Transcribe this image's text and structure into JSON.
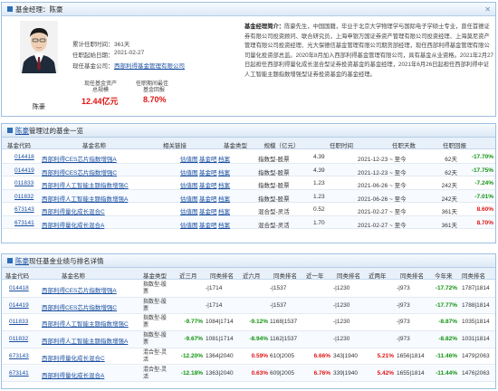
{
  "manager": {
    "header_label": "基金经理：",
    "name": "陈豪",
    "caption": "陈豪",
    "tenure_label": "累计任职时间：",
    "tenure_value": "361天",
    "start_label": "任职起始日期：",
    "start_value": "2021-02-27",
    "company_label": "现任基金公司：",
    "company_value": "西部利得基金管理有限公司",
    "scale_label_1": "现任基金资产",
    "scale_label_2": "总规模",
    "scale_value": "12.44亿元",
    "return_label_1": "任职期间最佳",
    "return_label_2": "基金回报",
    "return_value": "8.70%",
    "bio_title": "基金经理简介：",
    "bio_text": "陈豪先生，中国国籍，毕业于北京大学物理学与国际电子学硕士专业，曾任首德证券有限公司投资顾问、联合研究员，上海申银万国证券资产管理有限公司投资经理、上海莫尼资产管理有限公司投资经理、光大保德信基金管理有限公司期货部经理，现任西部利得基金管理有限公司量化投资部总监。2020年8月加入西部利得基金管理有限公司，具有基金从业资格。2021年2月27日起担任西部利得量化成长混合型证券投资基金的基金经理，2021年6月26日起担任西部利得中证人工智能主题指数增强型证券投资基金的基金经理。"
  },
  "managed_section": {
    "title_link": "陈豪",
    "title_rest": "管理过的基金一览",
    "headers": [
      "基金代码",
      "基金名称",
      "相关链接",
      "基金类型",
      "规模（亿元）",
      "任职时间",
      "任职天数",
      "任职回报"
    ],
    "rows": [
      {
        "code": "014418",
        "name": "西部利得CES芯片指数增强A",
        "links": [
          "估值图",
          "基金吧",
          "档案"
        ],
        "type": "指数型-股票",
        "size": "4.39",
        "period": "2021-12-23 ~ 至今",
        "days": "62天",
        "ret": "-17.70%"
      },
      {
        "code": "014419",
        "name": "西部利得CES芯片指数增强C",
        "links": [
          "估值图",
          "基金吧",
          "档案"
        ],
        "type": "指数型-股票",
        "size": "4.39",
        "period": "2021-12-23 ~ 至今",
        "days": "62天",
        "ret": "-17.75%"
      },
      {
        "code": "011833",
        "name": "西部利得人工智能主题指数增强C",
        "links": [
          "估值图",
          "基金吧",
          "档案"
        ],
        "type": "指数型-股票",
        "size": "1.23",
        "period": "2021-06-26 ~ 至今",
        "days": "242天",
        "ret": "-7.24%"
      },
      {
        "code": "011832",
        "name": "西部利得人工智能主题指数增强A",
        "links": [
          "估值图",
          "基金吧",
          "档案"
        ],
        "type": "指数型-股票",
        "size": "1.23",
        "period": "2021-06-26 ~ 至今",
        "days": "242天",
        "ret": "-7.01%"
      },
      {
        "code": "673143",
        "name": "西部利得量化成长混合C",
        "links": [
          "估值图",
          "基金吧",
          "档案"
        ],
        "type": "混合型-灵活",
        "size": "0.52",
        "period": "2021-02-27 ~ 至今",
        "days": "361天",
        "ret": "8.60%"
      },
      {
        "code": "673141",
        "name": "西部利得量化成长混合A",
        "links": [
          "估值图",
          "基金吧",
          "档案"
        ],
        "type": "混合型-灵活",
        "size": "1.70",
        "period": "2021-02-27 ~ 至今",
        "days": "361天",
        "ret": "8.70%"
      }
    ]
  },
  "current_section": {
    "title_link": "陈豪",
    "title_rest": "现任基金业绩与排名详情",
    "headers": [
      "基金代码",
      "基金名称",
      "基金类型",
      "近三月",
      "同类排名",
      "近六月",
      "同类排名",
      "近一年",
      "同类排名",
      "近两年",
      "同类排名",
      "今年来",
      "同类排名"
    ],
    "rows": [
      {
        "code": "014418",
        "name": "西部利得CES芯片指数增强A",
        "type": "指数型-股票",
        "m3": "",
        "r3": "-|1714",
        "m6": "",
        "r6": "-|1537",
        "y1": "",
        "ry1": "-|1230",
        "y2": "",
        "ry2": "-|973",
        "ytd": "-17.72%",
        "rytd": "1787|1814"
      },
      {
        "code": "014419",
        "name": "西部利得CES芯片指数增强C",
        "type": "指数型-股票",
        "m3": "",
        "r3": "-|1714",
        "m6": "",
        "r6": "-|1537",
        "y1": "",
        "ry1": "-|1230",
        "y2": "",
        "ry2": "-|973",
        "ytd": "-17.77%",
        "rytd": "1788|1814"
      },
      {
        "code": "011833",
        "name": "西部利得人工智能主题指数增强C",
        "type": "指数型-股票",
        "m3": "-9.77%",
        "r3": "1084|1714",
        "m6": "-9.12%",
        "r6": "1168|1537",
        "y1": "",
        "ry1": "-|1230",
        "y2": "",
        "ry2": "-|973",
        "ytd": "-8.87%",
        "rytd": "1035|1814"
      },
      {
        "code": "011832",
        "name": "西部利得人工智能主题指数增强A",
        "type": "指数型-股票",
        "m3": "-9.67%",
        "r3": "1081|1714",
        "m6": "-8.94%",
        "r6": "1162|1537",
        "y1": "",
        "ry1": "-|1230",
        "y2": "",
        "ry2": "-|973",
        "ytd": "-8.82%",
        "rytd": "1031|1814"
      },
      {
        "code": "673143",
        "name": "西部利得量化成长混合C",
        "type": "混合型-灵活",
        "m3": "-12.20%",
        "r3": "1364|2040",
        "m6": "0.59%",
        "r6": "610|2005",
        "y1": "6.66%",
        "ry1": "343|1940",
        "y2": "5.21%",
        "ry2": "1656|1814",
        "ytd": "-11.46%",
        "rytd": "1479|2063"
      },
      {
        "code": "673141",
        "name": "西部利得量化成长混合A",
        "type": "混合型-灵活",
        "m3": "-12.18%",
        "r3": "1363|2040",
        "m6": "0.63%",
        "r6": "609|2005",
        "y1": "6.76%",
        "ry1": "339|1940",
        "y2": "5.42%",
        "ry2": "1655|1814",
        "ytd": "-11.44%",
        "rytd": "1476|2063"
      }
    ]
  },
  "colors": {
    "link": "#1a4fa0",
    "negative": "#119411",
    "positive": "#e01515",
    "header_bg": "#e8f0fa",
    "border": "#9fbfe0"
  },
  "icons": {
    "panel_marker": "square-icon",
    "close": "close-icon"
  }
}
